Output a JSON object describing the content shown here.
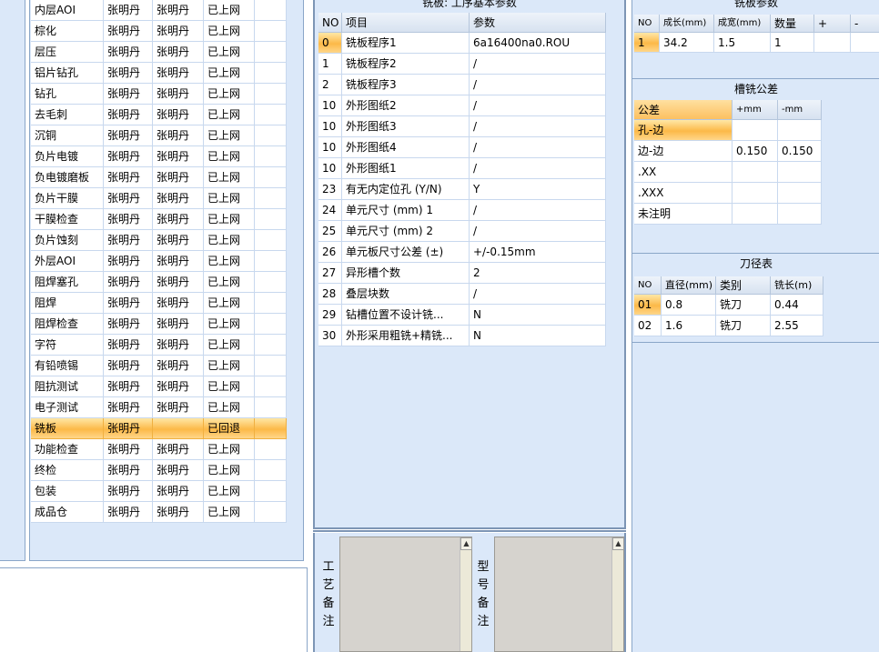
{
  "process_list": {
    "rows": [
      [
        "内层AOI",
        "张明丹",
        "张明丹",
        "已上网"
      ],
      [
        "棕化",
        "张明丹",
        "张明丹",
        "已上网"
      ],
      [
        "层压",
        "张明丹",
        "张明丹",
        "已上网"
      ],
      [
        "铝片钻孔",
        "张明丹",
        "张明丹",
        "已上网"
      ],
      [
        "钻孔",
        "张明丹",
        "张明丹",
        "已上网"
      ],
      [
        "去毛刺",
        "张明丹",
        "张明丹",
        "已上网"
      ],
      [
        "沉铜",
        "张明丹",
        "张明丹",
        "已上网"
      ],
      [
        "负片电镀",
        "张明丹",
        "张明丹",
        "已上网"
      ],
      [
        "负电镀磨板",
        "张明丹",
        "张明丹",
        "已上网"
      ],
      [
        "负片干膜",
        "张明丹",
        "张明丹",
        "已上网"
      ],
      [
        "干膜检查",
        "张明丹",
        "张明丹",
        "已上网"
      ],
      [
        "负片蚀刻",
        "张明丹",
        "张明丹",
        "已上网"
      ],
      [
        "外层AOI",
        "张明丹",
        "张明丹",
        "已上网"
      ],
      [
        "阻焊塞孔",
        "张明丹",
        "张明丹",
        "已上网"
      ],
      [
        "阻焊",
        "张明丹",
        "张明丹",
        "已上网"
      ],
      [
        "阻焊检查",
        "张明丹",
        "张明丹",
        "已上网"
      ],
      [
        "字符",
        "张明丹",
        "张明丹",
        "已上网"
      ],
      [
        "有铅喷锡",
        "张明丹",
        "张明丹",
        "已上网"
      ],
      [
        "阻抗测试",
        "张明丹",
        "张明丹",
        "已上网"
      ],
      [
        "电子测试",
        "张明丹",
        "张明丹",
        "已上网"
      ],
      [
        "铣板",
        "张明丹",
        "",
        "已回退"
      ],
      [
        "功能检查",
        "张明丹",
        "张明丹",
        "已上网"
      ],
      [
        "终检",
        "张明丹",
        "张明丹",
        "已上网"
      ],
      [
        "包装",
        "张明丹",
        "张明丹",
        "已上网"
      ],
      [
        "成品仓",
        "张明丹",
        "张明丹",
        "已上网"
      ]
    ],
    "selected_index": 20
  },
  "mill_params": {
    "title": "铣板: 工序基本参数",
    "headers": [
      "NO",
      "项目",
      "参数"
    ],
    "rows": [
      [
        "0",
        "铣板程序1",
        "6a16400na0.ROU"
      ],
      [
        "1",
        "铣板程序2",
        "/"
      ],
      [
        "2",
        "铣板程序3",
        "/"
      ],
      [
        "10",
        "外形图纸2",
        "/"
      ],
      [
        "10",
        "外形图纸3",
        "/"
      ],
      [
        "10",
        "外形图纸4",
        "/"
      ],
      [
        "10",
        "外形图纸1",
        "/"
      ],
      [
        "23",
        "有无内定位孔 (Y/N)",
        "Y"
      ],
      [
        "24",
        "单元尺寸 (mm) 1",
        "/"
      ],
      [
        "25",
        "单元尺寸 (mm) 2",
        "/"
      ],
      [
        "26",
        "单元板尺寸公差 (±)",
        "+/-0.15mm"
      ],
      [
        "27",
        "异形槽个数",
        "2"
      ],
      [
        "28",
        "叠层块数",
        "/"
      ],
      [
        "29",
        "钻槽位置不设计铣...",
        "N"
      ],
      [
        "30",
        "外形采用粗铣+精铣...",
        "N"
      ]
    ]
  },
  "memo": {
    "process_label": "工艺备注",
    "model_label": "型号备注",
    "scroll_up": "▲"
  },
  "mill_board_params": {
    "title": "铣板参数",
    "headers": [
      "NO",
      "成长(mm)",
      "成宽(mm)",
      "数量",
      "+",
      "-"
    ],
    "rows": [
      [
        "1",
        "34.2",
        "1.5",
        "1",
        "",
        ""
      ]
    ]
  },
  "slot_tolerance": {
    "title": "槽铣公差",
    "headers": [
      "公差",
      "+mm",
      "-mm"
    ],
    "rows": [
      [
        "孔-边",
        "",
        ""
      ],
      [
        "边-边",
        "0.150",
        "0.150"
      ],
      [
        ".XX",
        "",
        ""
      ],
      [
        ".XXX",
        "",
        ""
      ],
      [
        "未注明",
        "",
        ""
      ]
    ]
  },
  "tool_table": {
    "title": "刀径表",
    "headers": [
      "NO",
      "直径(mm)",
      "类别",
      "铣长(m)"
    ],
    "rows": [
      [
        "01",
        "0.8",
        "铣刀",
        "0.44"
      ],
      [
        "02",
        "1.6",
        "铣刀",
        "2.55"
      ]
    ]
  }
}
